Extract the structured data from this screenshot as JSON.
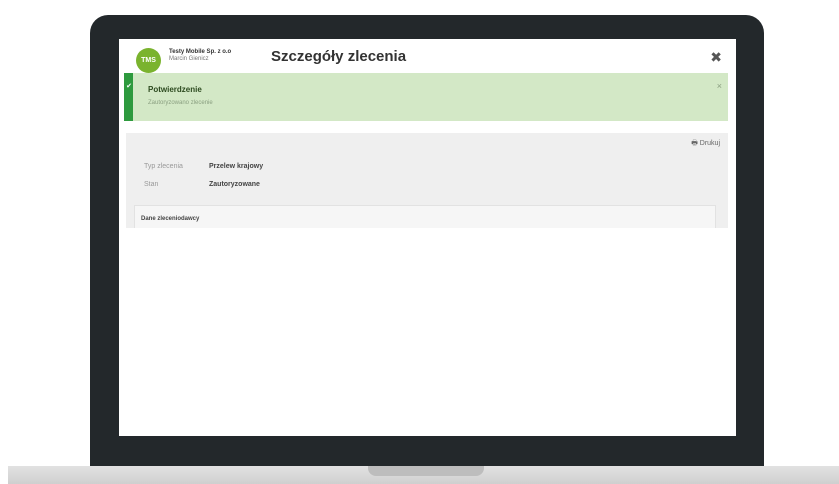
{
  "header": {
    "logo_text": "TMS",
    "company_name": "Testy Mobile Sp. z o.o",
    "user_name": "Marcin Gienicz",
    "title": "Szczegóły zlecenia",
    "close_icon": "✖"
  },
  "alert": {
    "check_icon": "✔",
    "title": "Potwierdzenie",
    "text": "Zautoryzowano zlecenie",
    "close_icon": "×"
  },
  "details": {
    "print_label": "🖶 Drukuj",
    "fields": [
      {
        "label": "Typ zlecenia",
        "value": "Przelew krajowy"
      },
      {
        "label": "Stan",
        "value": "Zautoryzowane"
      }
    ],
    "section_title": "Dane zleceniodawcy"
  },
  "colors": {
    "accent_green": "#2e9a3e",
    "alert_bg": "#d3e8c6",
    "logo_green": "#7ab32e"
  }
}
